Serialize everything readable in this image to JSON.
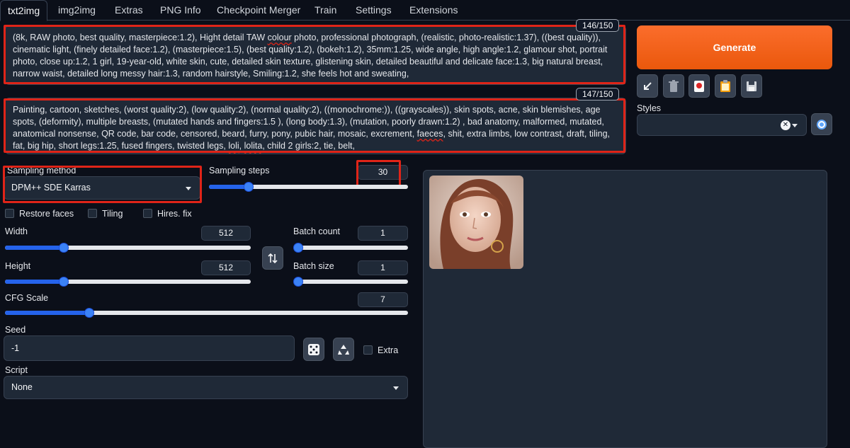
{
  "tabs": [
    "txt2img",
    "img2img",
    "Extras",
    "PNG Info",
    "Checkpoint Merger",
    "Train",
    "Settings",
    "Extensions"
  ],
  "positive_prompt": {
    "counter": "146/150",
    "parts": [
      "(8k, RAW photo, best quality, masterpiece:1.2), Hight detail TAW ",
      "colour",
      " photo, professional photograph, (realistic, photo-realistic:1.37), ((best quality)), cinematic light, (finely detailed face:1.2), (masterpiece:1.5), (best quality:1.2), (bokeh:1.2), 35mm:1.25, wide angle, high angle:1.2, glamour shot, portrait photo, close up:1.2, 1 girl, 19-year-old, white skin, cute, detailed skin texture, glistening skin, detailed beautiful and delicate face:1.3, big natural breast, narrow waist, detailed long messy hair:1.3, random hairstyle, Smiling:1.2, she feels hot and sweating,"
    ]
  },
  "negative_prompt": {
    "counter": "147/150",
    "parts": [
      "Painting, cartoon, sketches, (worst quality:2), (low quality:2), (normal quality:2), ((monochrome:)), ((grayscales)), skin spots, acne, skin blemishes, age spots, (deformity), multiple breasts, (mutated hands and fingers:1.5 ), (long body:1.3), (mutation, poorly drawn:1.2) , bad anatomy, malformed, mutated, anatomical nonsense, QR code, bar code, censored, beard, furry, pony, pubic hair, mosaic, excrement, ",
      "faeces",
      ", shit, extra limbs, low contrast, draft, tiling, fat, big hip, short legs:1.25, fused fingers, twisted legs, ",
      "loli",
      ", ",
      "lolita",
      ", child 2 girls:2, tie, belt,"
    ]
  },
  "generate_label": "Generate",
  "tools": [
    "arrow-icon",
    "trash-icon",
    "red-card-icon",
    "clipboard-icon",
    "save-icon"
  ],
  "styles_label": "Styles",
  "styles_clear": "✕",
  "sampling": {
    "method_label": "Sampling method",
    "method_value": "DPM++ SDE Karras",
    "steps_label": "Sampling steps",
    "steps_value": "30",
    "steps_fraction": 0.2
  },
  "checkboxes": {
    "restore_faces": "Restore faces",
    "tiling": "Tiling",
    "hires_fix": "Hires. fix"
  },
  "width": {
    "label": "Width",
    "value": "512",
    "fraction": 0.24
  },
  "height": {
    "label": "Height",
    "value": "512",
    "fraction": 0.24
  },
  "batch_count": {
    "label": "Batch count",
    "value": "1",
    "fraction": 0.0
  },
  "batch_size": {
    "label": "Batch size",
    "value": "1",
    "fraction": 0.0
  },
  "cfg": {
    "label": "CFG Scale",
    "value": "7",
    "fraction": 0.21
  },
  "seed": {
    "label": "Seed",
    "value": "-1",
    "extra_label": "Extra"
  },
  "script": {
    "label": "Script",
    "value": "None"
  },
  "colors": {
    "accent": "#ea580c",
    "slider": "#3b82f6",
    "highlight": "#e02418"
  }
}
